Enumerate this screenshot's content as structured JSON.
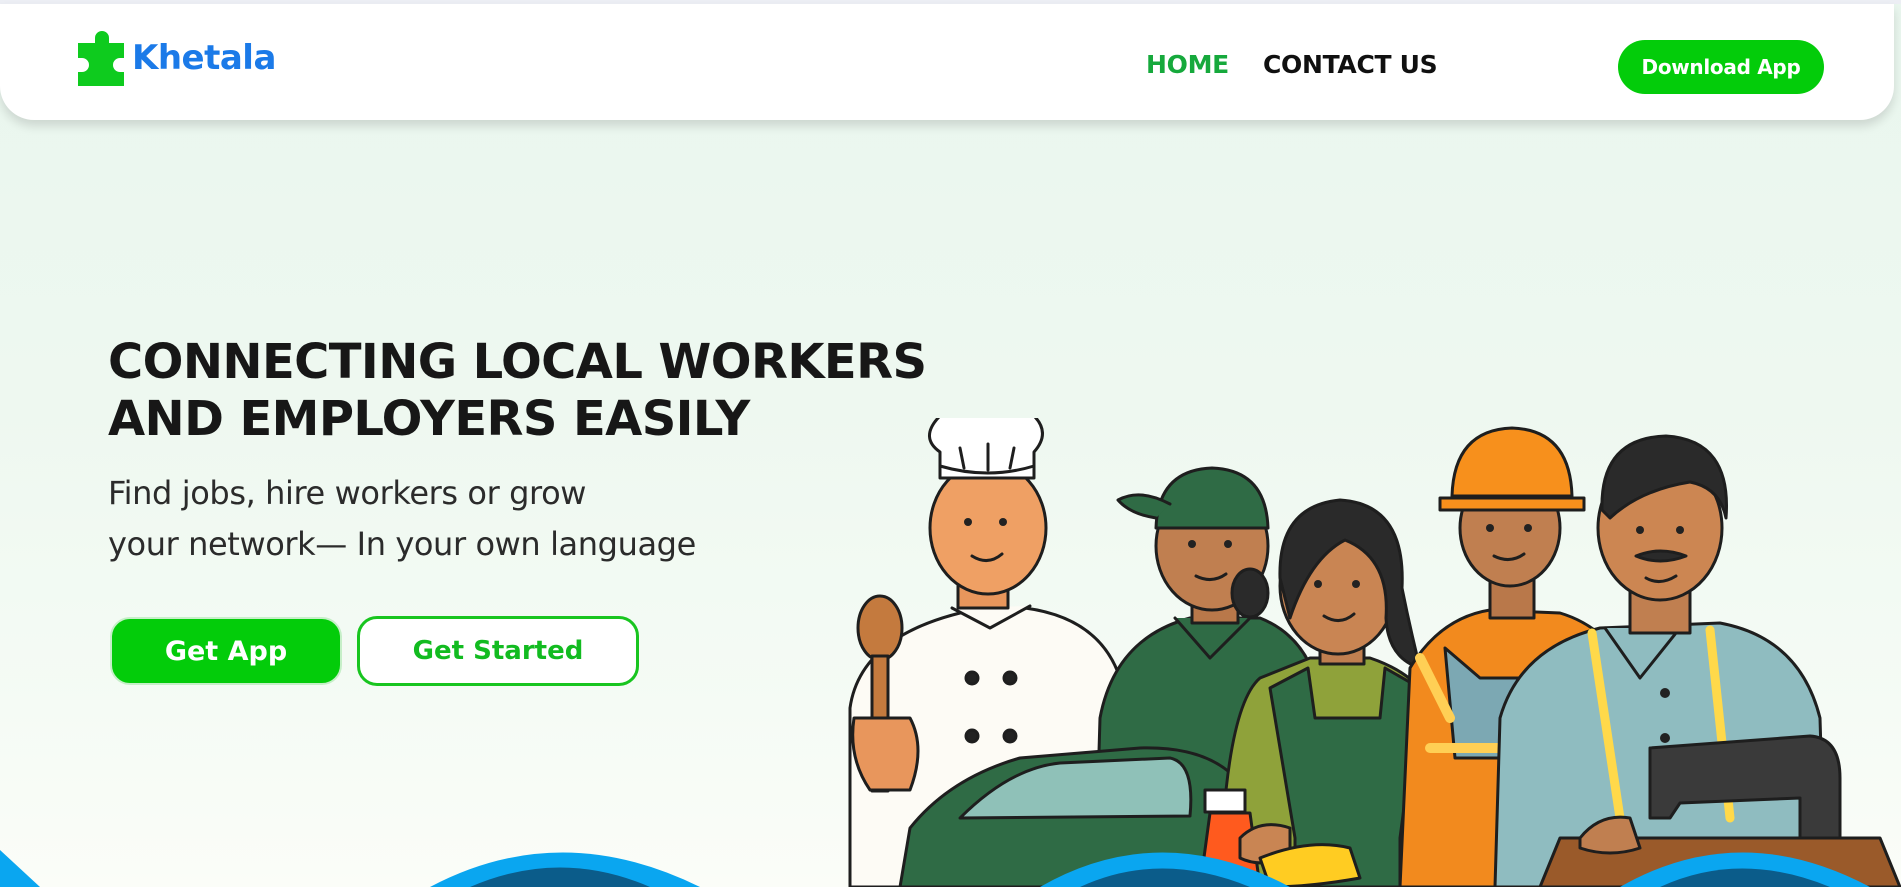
{
  "brand": {
    "name": "Khetala",
    "logo_icon": "puzzle-piece-icon",
    "text_color": "#1b7ae8",
    "icon_color": "#0ecb1e"
  },
  "nav": {
    "links": [
      {
        "label": "HOME",
        "active": true
      },
      {
        "label": "CONTACT US",
        "active": false
      }
    ],
    "download_label": "Download App"
  },
  "hero": {
    "headline_line1": "CONNECTING LOCAL WORKERS",
    "headline_line2": "AND EMPLOYERS EASILY",
    "sub_line1": "Find jobs, hire workers or grow",
    "sub_line2": "your network— In your own language",
    "primary_cta": "Get App",
    "secondary_cta": "Get Started",
    "illustration": "group of local workers: chef, mechanic, cleaner, construction worker, tailor"
  },
  "colors": {
    "accent_green": "#03cc0a",
    "active_nav": "#16a93c",
    "hero_background": "#e9f6ee",
    "wave_blue": "#0aa6f0"
  }
}
